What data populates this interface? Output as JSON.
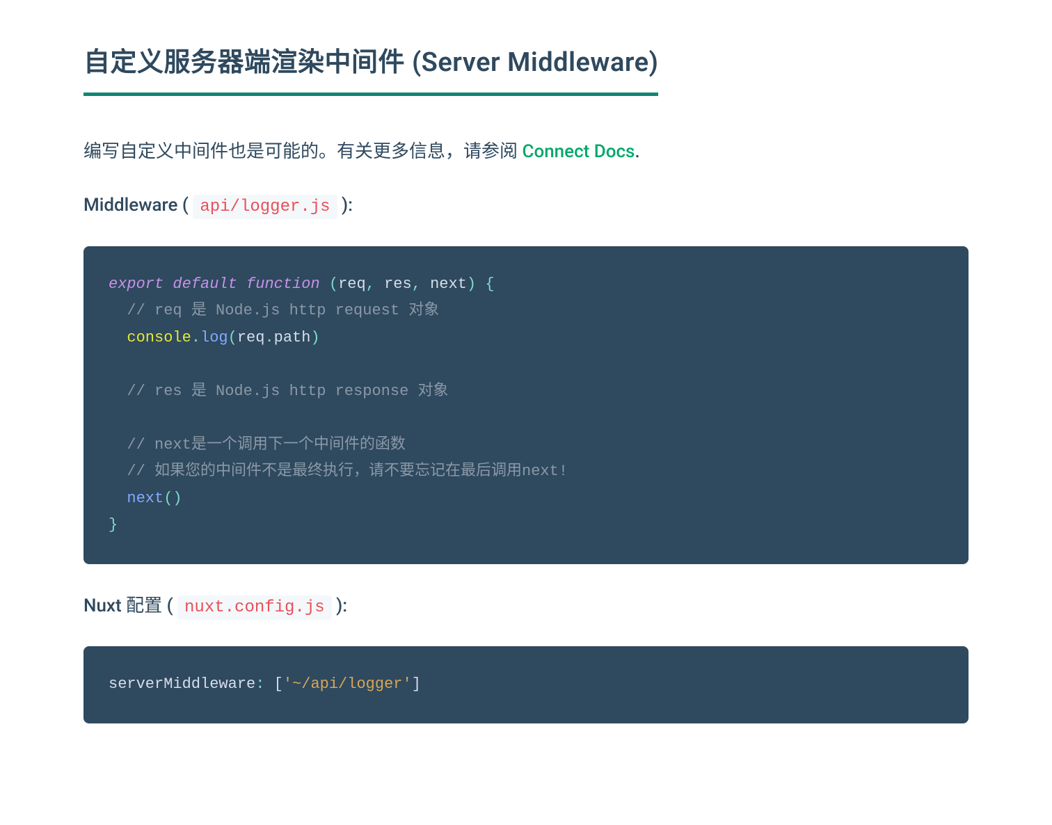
{
  "heading": "自定义服务器端渲染中间件 (Server Middleware)",
  "intro": {
    "before_link": "编写自定义中间件也是可能的。有关更多信息，请参阅 ",
    "link_text": "Connect Docs",
    "after_link": "."
  },
  "mw_label": {
    "before": "Middleware ( ",
    "code": "api/logger.js",
    "after": " ):"
  },
  "code1": {
    "l1": {
      "export": "export",
      "default": "default",
      "function": "function",
      "open": " (",
      "req": "req",
      "c1": ",",
      "sp1": " ",
      "res": "res",
      "c2": ",",
      "sp2": " ",
      "next": "next",
      "close": ")",
      "brace": " {"
    },
    "l2": "  // req 是 Node.js http request 对象",
    "l3": {
      "indent": "  ",
      "console": "console",
      "dot1": ".",
      "log": "log",
      "open": "(",
      "req": "req",
      "dot2": ".",
      "path": "path",
      "close": ")"
    },
    "l4": "  // res 是 Node.js http response 对象",
    "l5": "  // next是一个调用下一个中间件的函数",
    "l6": "  // 如果您的中间件不是最终执行，请不要忘记在最后调用next!",
    "l7": {
      "indent": "  ",
      "next": "next",
      "open": "(",
      "close": ")"
    },
    "l8": "}"
  },
  "cfg_label": {
    "before": "Nuxt 配置 ( ",
    "code": "nuxt.config.js",
    "after": " ):"
  },
  "code2": {
    "key": "serverMiddleware",
    "colon": ":",
    "sp": " ",
    "open": "[",
    "str": "'~/api/logger'",
    "close": "]"
  }
}
